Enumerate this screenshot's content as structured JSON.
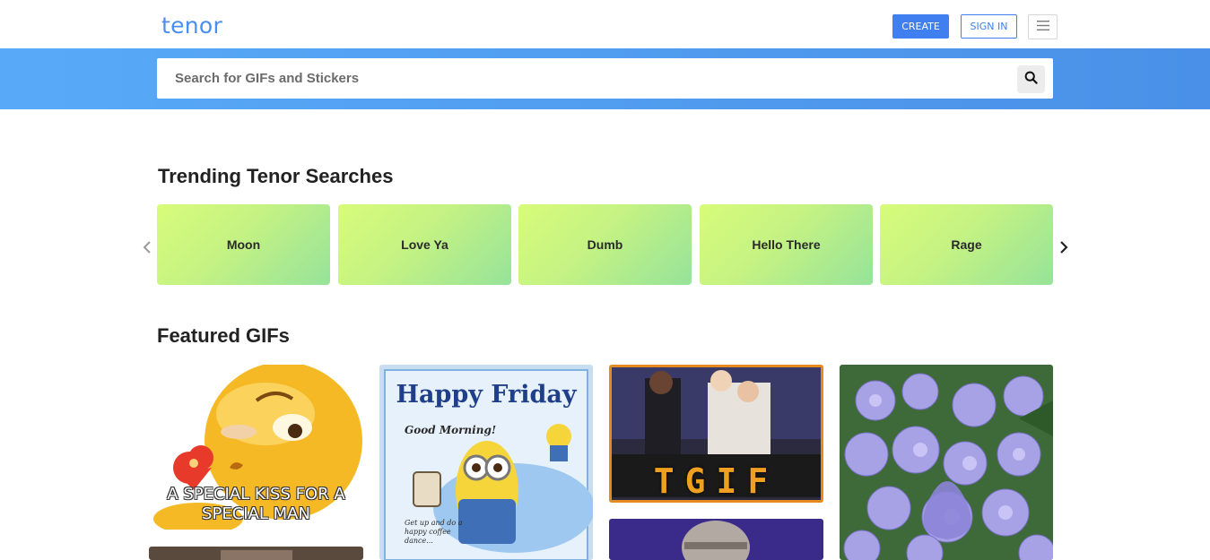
{
  "header": {
    "logo": "tenor",
    "create_label": "CREATE",
    "signin_label": "SIGN IN",
    "menu_icon": "hamburger-menu-icon"
  },
  "search": {
    "placeholder": "Search for GIFs and Stickers",
    "value": "",
    "icon": "search-icon"
  },
  "trending": {
    "title": "Trending Tenor Searches",
    "items": [
      {
        "label": "Moon"
      },
      {
        "label": "Love Ya"
      },
      {
        "label": "Dumb"
      },
      {
        "label": "Hello There"
      },
      {
        "label": "Rage"
      }
    ],
    "prev_icon": "chevron-left-icon",
    "next_icon": "chevron-right-icon"
  },
  "featured": {
    "title": "Featured GIFs",
    "gifs": [
      {
        "caption": "A SPECIAL KISS FOR A SPECIAL MAN"
      },
      {
        "heading": "Happy Friday",
        "subheading": "Good Morning!",
        "note": "Get up and do a happy coffee dance..."
      },
      {
        "caption": "TGIF"
      },
      {
        "caption": ""
      }
    ]
  },
  "colors": {
    "brand": "#4a8ef0",
    "button": "#3f7ff0",
    "search_band_start": "#58aaf8",
    "search_band_end": "#4a90e8",
    "tile_start": "#d8fc7a",
    "tile_end": "#96e39a"
  }
}
